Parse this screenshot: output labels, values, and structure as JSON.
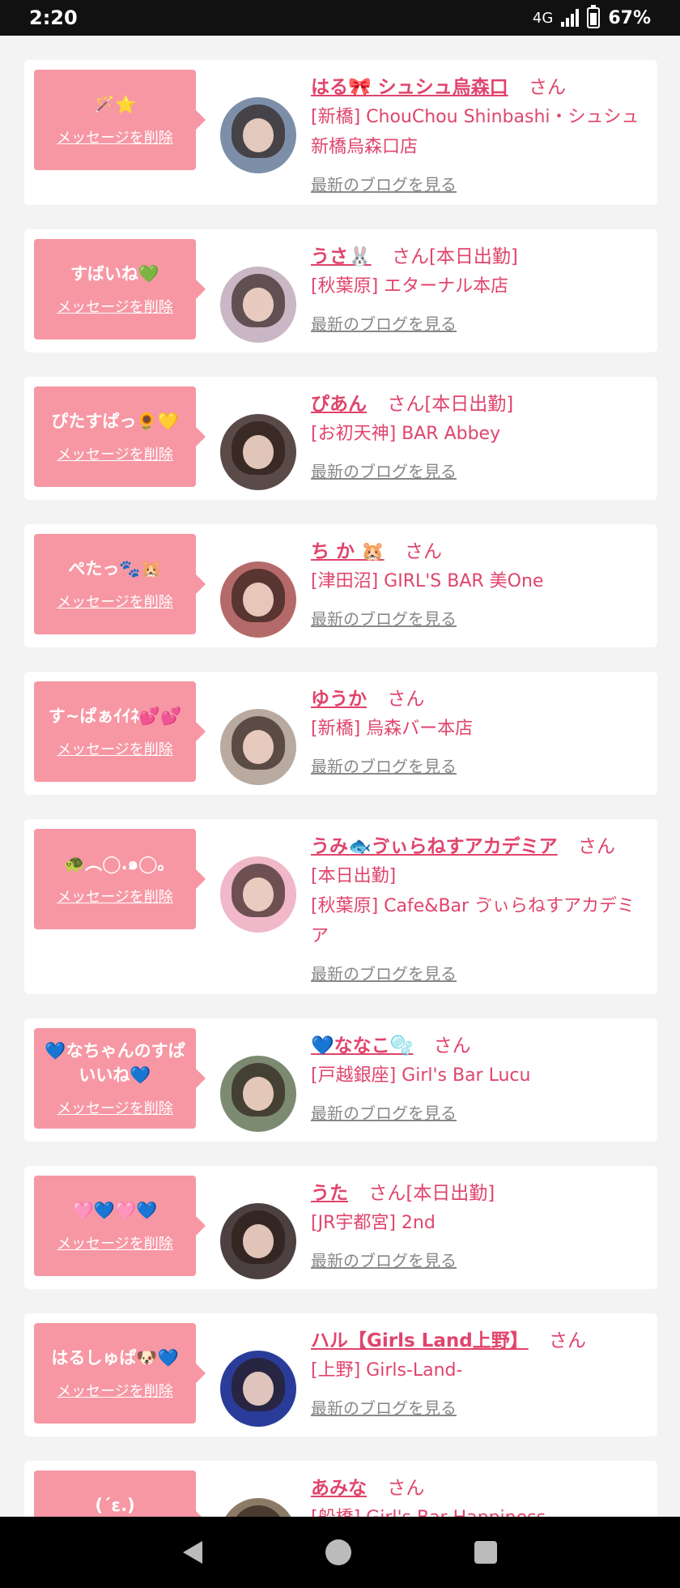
{
  "status_bar": {
    "time": "2:20",
    "network": "4G",
    "battery": "67%"
  },
  "colors": {
    "accent": "#e0446c",
    "bubble": "#f797a4",
    "link_gray": "#888888"
  },
  "common": {
    "delete_label": "メッセージを削除",
    "blog_label": "最新のブログを見る",
    "san": "さん"
  },
  "items": [
    {
      "message": "🪄⭐",
      "name": "はる🎀 シュシュ烏森口",
      "status": "",
      "shops": [
        "[新橋] ChouChou Shinbashi・シュシュ新橋烏森口店"
      ],
      "avatar_bg": "#7d8fa8"
    },
    {
      "message": "すばいね💚",
      "name": "うさ🐰",
      "status": "[本日出勤]",
      "shops": [
        "[秋葉原] エターナル本店"
      ],
      "avatar_bg": "#c9b7c5"
    },
    {
      "message": "ぴたすぱっ🌻💛",
      "name": "ぴあん",
      "status": "[本日出勤]",
      "shops": [
        "[お初天神] BAR Abbey"
      ],
      "avatar_bg": "#5a4b48"
    },
    {
      "message": "ぺたっ🐾🐹",
      "name": "ち か 🐹",
      "status": "",
      "shops": [
        "[津田沼] GIRL'S BAR 美One"
      ],
      "avatar_bg": "#b56a6a"
    },
    {
      "message": "す~ぱぁｲｲﾈ💕💕",
      "name": "ゆうか",
      "status": "",
      "shops": [
        "[新橋] 烏森バー本店"
      ],
      "avatar_bg": "#b9aaa0"
    },
    {
      "message": "🐢︵◯.๑◯｡",
      "name": "うみ🐟ゔぃらねすアカデミア",
      "status": "",
      "shops": [
        "[本日出勤]",
        "[秋葉原] Cafe&Bar ゔぃらねすアカデミア"
      ],
      "avatar_bg": "#f0b8c8"
    },
    {
      "message": "💙なちゃんのすぱいいね💙",
      "name": "💙ななこ🫧",
      "status": "",
      "shops": [
        "[戸越銀座] Girl's Bar Lucu"
      ],
      "avatar_bg": "#7b8a70"
    },
    {
      "message": "🩷💙🩷💙",
      "name": "うた",
      "status": "[本日出勤]",
      "shops": [
        "[JR宇都宮] 2nd"
      ],
      "avatar_bg": "#4c4040"
    },
    {
      "message": "はるしゅぱ🐶💙",
      "name": "ハル【Girls Land上野】",
      "status": "",
      "shops": [
        "[上野] Girls-Land-"
      ],
      "avatar_bg": "#2a3c9a"
    },
    {
      "message": "(´ε.)",
      "name": "あみな",
      "status": "",
      "shops": [
        "[船橋] Girl's Bar Happiness"
      ],
      "avatar_bg": "#8b7b66"
    }
  ]
}
